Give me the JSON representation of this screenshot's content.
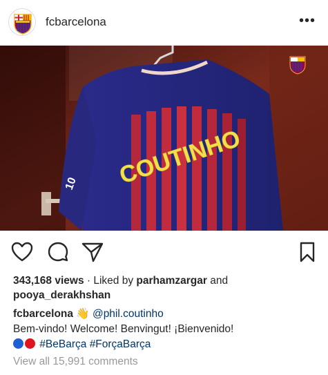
{
  "header": {
    "username": "fcbarcelona",
    "more_label": "•••"
  },
  "photo": {
    "jersey_name": "COUTINHO",
    "jersey_number": "10",
    "logo_text": "FCB"
  },
  "actions": {
    "like_icon": "heart-icon",
    "comment_icon": "comment-icon",
    "share_icon": "paper-plane-icon",
    "save_icon": "bookmark-icon"
  },
  "stats": {
    "views": "343,168 views",
    "liked_by_prefix": " · Liked by ",
    "liked_by_user": "parhamzargar",
    "and_text": " and",
    "second_user": "pooya_derakhshan"
  },
  "caption": {
    "username": "fcbarcelona",
    "wave_emoji": "👋",
    "mention": "@phil.coutinho",
    "line2": "Bem-vindo! Welcome! Benvingut! ¡Bienvenido!",
    "hashtags": "#BeBarça #ForçaBarça"
  },
  "comments": {
    "view_all": "View all 15,991 comments"
  },
  "colors": {
    "blue_dot": "#1f5fd6",
    "red_dot": "#e0141e",
    "link": "#003569"
  }
}
